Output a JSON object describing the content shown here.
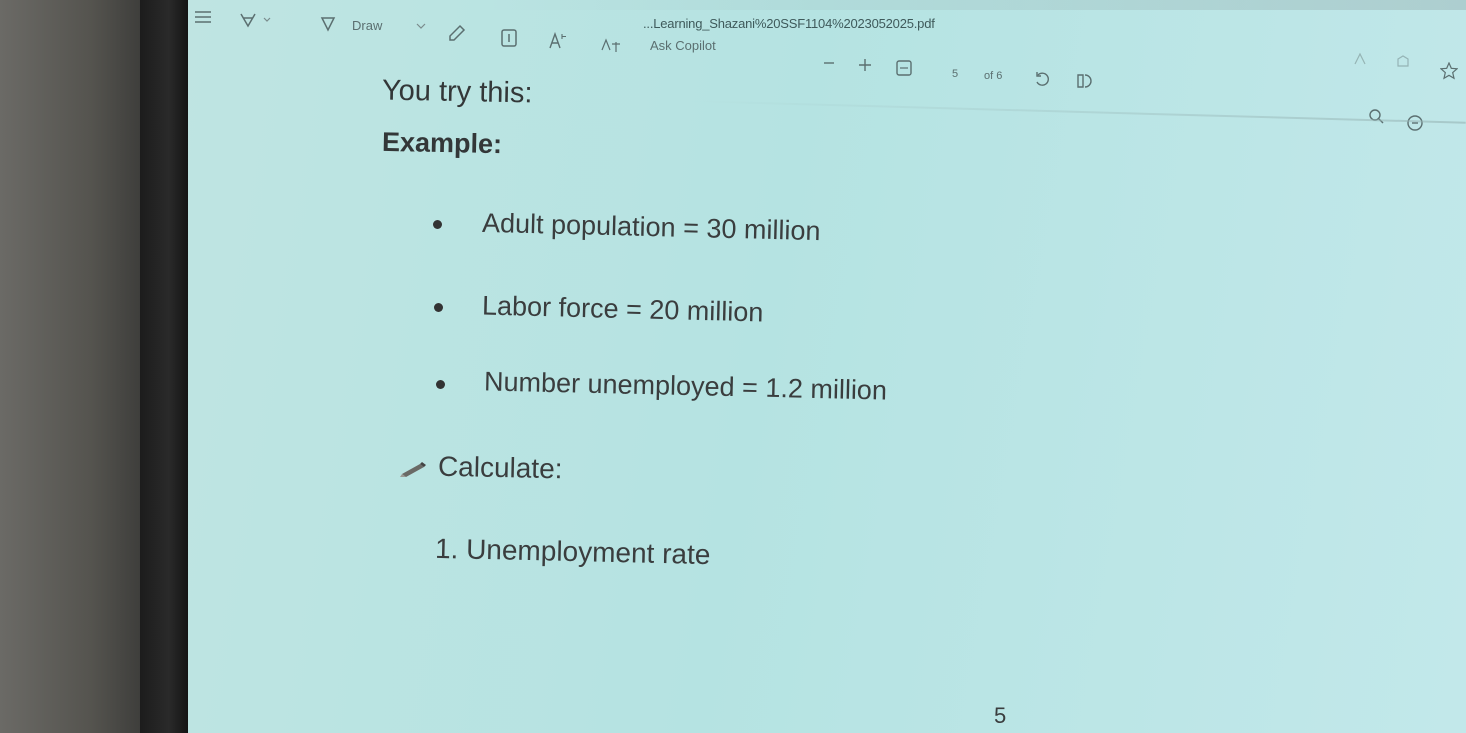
{
  "window": {
    "filename": "...Learning_Shazani%20SSF1104%2023052025.pdf"
  },
  "toolbar": {
    "draw_label": "Draw",
    "ask_copilot_label": "Ask Copilot",
    "page_current": "5",
    "page_of_label": "of 6"
  },
  "document": {
    "title": "You try this:",
    "example_heading": "Example:",
    "bullets": [
      "Adult population = 30 million",
      "Labor force = 20 million",
      "Number unemployed = 1.2 million"
    ],
    "calculate_label": "Calculate:",
    "tasks": [
      "1.  Unemployment rate"
    ],
    "page_number": "5"
  },
  "colors": {
    "screen_bg": "#b5e3e2",
    "text": "#3a3d3e",
    "toolbar_icon": "#5b6f70"
  },
  "icons": [
    "menu-icon",
    "highlight-icon",
    "draw-icon",
    "erase-icon",
    "text-box-icon",
    "read-aloud-icon",
    "translate-icon",
    "zoom-out-icon",
    "zoom-in-icon",
    "fit-page-icon",
    "rotate-icon",
    "page-view-icon",
    "favorite-icon",
    "search-icon",
    "settings-icon"
  ]
}
